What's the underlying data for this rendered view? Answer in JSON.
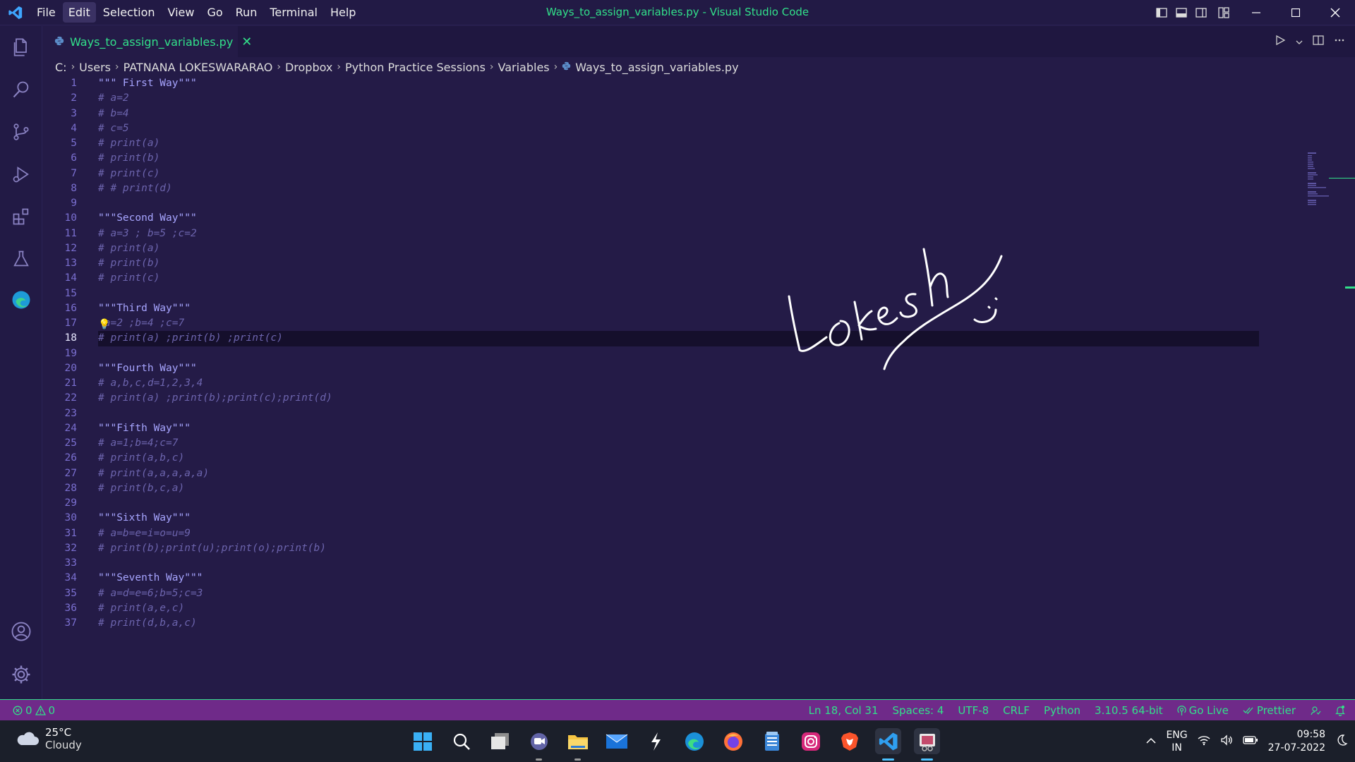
{
  "window": {
    "title": "Ways_to_assign_variables.py - Visual Studio Code"
  },
  "menu": [
    "File",
    "Edit",
    "Selection",
    "View",
    "Go",
    "Run",
    "Terminal",
    "Help"
  ],
  "active_menu_index": 1,
  "tab": {
    "label": "Ways_to_assign_variables.py",
    "close": "✕"
  },
  "breadcrumb": [
    "C:",
    "Users",
    "PATNANA LOKESWARARAO",
    "Dropbox",
    "Python Practice Sessions",
    "Variables",
    "Ways_to_assign_variables.py"
  ],
  "editor": {
    "current_line": 18,
    "lines": [
      {
        "n": "1",
        "text": "\"\"\" First Way\"\"\"",
        "type": "str"
      },
      {
        "n": "2",
        "text": "# a=2",
        "type": "cmt"
      },
      {
        "n": "3",
        "text": "# b=4",
        "type": "cmt"
      },
      {
        "n": "4",
        "text": "# c=5",
        "type": "cmt"
      },
      {
        "n": "5",
        "text": "# print(a)",
        "type": "cmt"
      },
      {
        "n": "6",
        "text": "# print(b)",
        "type": "cmt"
      },
      {
        "n": "7",
        "text": "# print(c)",
        "type": "cmt"
      },
      {
        "n": "8",
        "text": "# # print(d)",
        "type": "cmt"
      },
      {
        "n": "9",
        "text": "",
        "type": "cmt"
      },
      {
        "n": "10",
        "text": "\"\"\"Second Way\"\"\"",
        "type": "str"
      },
      {
        "n": "11",
        "text": "# a=3 ; b=5 ;c=2",
        "type": "cmt"
      },
      {
        "n": "12",
        "text": "# print(a)",
        "type": "cmt"
      },
      {
        "n": "13",
        "text": "# print(b)",
        "type": "cmt"
      },
      {
        "n": "14",
        "text": "# print(c)",
        "type": "cmt"
      },
      {
        "n": "15",
        "text": "",
        "type": "cmt"
      },
      {
        "n": "16",
        "text": "\"\"\"Third Way\"\"\"",
        "type": "str"
      },
      {
        "n": "17",
        "text": " a=2 ;b=4 ;c=7",
        "type": "cmt",
        "bulb": true
      },
      {
        "n": "18",
        "text": "# print(a) ;print(b) ;print(c)",
        "type": "cmt"
      },
      {
        "n": "19",
        "text": "",
        "type": "cmt"
      },
      {
        "n": "20",
        "text": "\"\"\"Fourth Way\"\"\"",
        "type": "str"
      },
      {
        "n": "21",
        "text": "# a,b,c,d=1,2,3,4",
        "type": "cmt"
      },
      {
        "n": "22",
        "text": "# print(a) ;print(b);print(c);print(d)",
        "type": "cmt"
      },
      {
        "n": "23",
        "text": "",
        "type": "cmt"
      },
      {
        "n": "24",
        "text": "\"\"\"Fifth Way\"\"\"",
        "type": "str"
      },
      {
        "n": "25",
        "text": "# a=1;b=4;c=7",
        "type": "cmt"
      },
      {
        "n": "26",
        "text": "# print(a,b,c)",
        "type": "cmt"
      },
      {
        "n": "27",
        "text": "# print(a,a,a,a,a)",
        "type": "cmt"
      },
      {
        "n": "28",
        "text": "# print(b,c,a)",
        "type": "cmt"
      },
      {
        "n": "29",
        "text": "",
        "type": "cmt"
      },
      {
        "n": "30",
        "text": "\"\"\"Sixth Way\"\"\"",
        "type": "str"
      },
      {
        "n": "31",
        "text": "# a=b=e=i=o=u=9",
        "type": "cmt"
      },
      {
        "n": "32",
        "text": "# print(b);print(u);print(o);print(b)",
        "type": "cmt"
      },
      {
        "n": "33",
        "text": "",
        "type": "cmt"
      },
      {
        "n": "34",
        "text": "\"\"\"Seventh Way\"\"\"",
        "type": "str"
      },
      {
        "n": "35",
        "text": "# a=d=e=6;b=5;c=3",
        "type": "cmt"
      },
      {
        "n": "36",
        "text": "# print(a,e,c)",
        "type": "cmt"
      },
      {
        "n": "37",
        "text": "# print(d,b,a,c)",
        "type": "cmt"
      }
    ]
  },
  "handwriting": "Lokesh",
  "status": {
    "errors": "0",
    "warnings": "0",
    "position": "Ln 18, Col 31",
    "spaces": "Spaces: 4",
    "encoding": "UTF-8",
    "eol": "CRLF",
    "language": "Python",
    "interpreter": "3.10.5 64-bit",
    "golive": "Go Live",
    "prettier": "Prettier"
  },
  "taskbar": {
    "temp": "25°C",
    "condition": "Cloudy",
    "lang_top": "ENG",
    "lang_bottom": "IN",
    "time": "09:58",
    "date": "27-07-2022",
    "apps": [
      "windows-start",
      "search",
      "task-view",
      "teams-chat",
      "file-explorer",
      "mail",
      "app-s",
      "edge",
      "firefox",
      "notepad",
      "instagram",
      "brave",
      "vscode",
      "snipping-tool"
    ]
  },
  "colors": {
    "accent": "#32e08a",
    "background": "#241b47",
    "statusbar": "#6f2a89"
  }
}
